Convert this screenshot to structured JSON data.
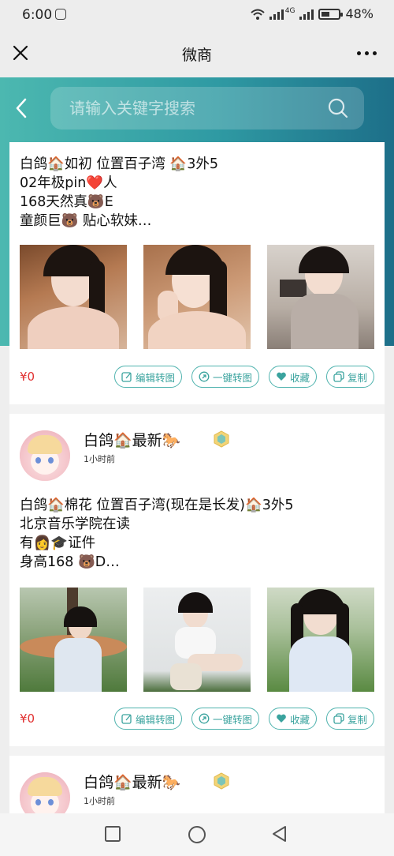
{
  "status_bar": {
    "time": "6:00",
    "network": "4G",
    "battery": "48%",
    "battery_level": 0.48
  },
  "titlebar": {
    "title": "微商"
  },
  "search": {
    "placeholder": "请输入关键字搜索"
  },
  "actions": {
    "edit": "编辑转图",
    "one_click": "一键转图",
    "favorite": "收藏",
    "copy": "复制"
  },
  "posts": [
    {
      "lines": [
        "白鸽🏠如初 位置百子湾 🏠3外5",
        "02年极pin❤️人",
        "168天然真🐻E",
        "童颜巨🐻 贴心软妹…"
      ],
      "price": "¥0"
    },
    {
      "poster_name": "白鸽🏠最新🐎",
      "time": "1小时前",
      "lines": [
        "白鸽🏠棉花 位置百子湾(现在是长发)🏠3外5",
        "北京音乐学院在读",
        "有👩🎓证件",
        "身高168 🐻D…"
      ],
      "price": "¥0"
    },
    {
      "poster_name": "白鸽🏠最新🐎",
      "time": "1小时前"
    }
  ],
  "colors": {
    "accent": "#3aa39e",
    "header_start": "#4cb8b0",
    "header_end": "#1d6f89",
    "price": "#e13030"
  },
  "icons": [
    "close-icon",
    "more-icon",
    "back-icon",
    "search-icon",
    "edit-icon",
    "share-icon",
    "heart-icon",
    "copy-icon",
    "vip-badge-icon",
    "nav-square-icon",
    "nav-circle-icon",
    "nav-triangle-icon"
  ]
}
